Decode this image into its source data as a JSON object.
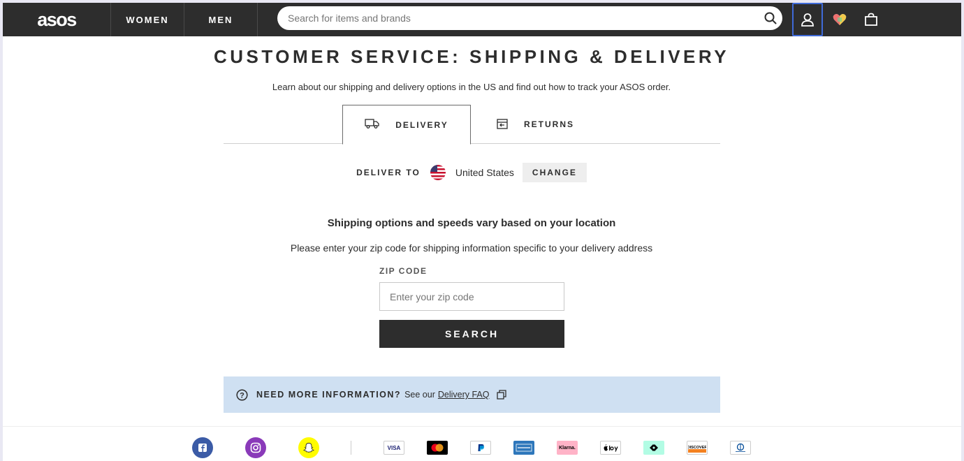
{
  "header": {
    "logo": "asos",
    "nav": [
      "WOMEN",
      "MEN"
    ],
    "search_placeholder": "Search for items and brands",
    "icons": [
      "search-icon",
      "account-icon",
      "saved-items-icon",
      "bag-icon"
    ]
  },
  "main": {
    "title": "CUSTOMER SERVICE: SHIPPING & DELIVERY",
    "subtitle": "Learn about our shipping and delivery options in the US and find out how to track your ASOS order.",
    "tabs": [
      {
        "label": "DELIVERY",
        "icon": "truck-icon",
        "active": true
      },
      {
        "label": "RETURNS",
        "icon": "returns-icon",
        "active": false
      }
    ],
    "deliver_to": {
      "label": "DELIVER TO",
      "country": "United States",
      "flag": "us-flag-icon",
      "change": "CHANGE"
    },
    "shipping_heading": "Shipping options and speeds vary based on your location",
    "shipping_sub": "Please enter your zip code for shipping information specific to your delivery address",
    "zip": {
      "label": "ZIP CODE",
      "placeholder": "Enter your zip code",
      "value": ""
    },
    "search_button": "SEARCH",
    "info": {
      "strong": "NEED MORE INFORMATION?",
      "see": "See our",
      "link": "Delivery FAQ"
    }
  },
  "footer": {
    "social": [
      "facebook-icon",
      "instagram-icon",
      "snapchat-icon"
    ],
    "payments": [
      "VISA",
      "Mastercard",
      "PayPal",
      "American Express",
      "Klarna.",
      "Apple Pay",
      "Afterpay",
      "DISCOVER",
      "Diners Club"
    ]
  },
  "colors": {
    "header_bg": "#2d2d2d",
    "info_bg": "#cfe0f2",
    "accent_focus": "#3f6ad8"
  }
}
